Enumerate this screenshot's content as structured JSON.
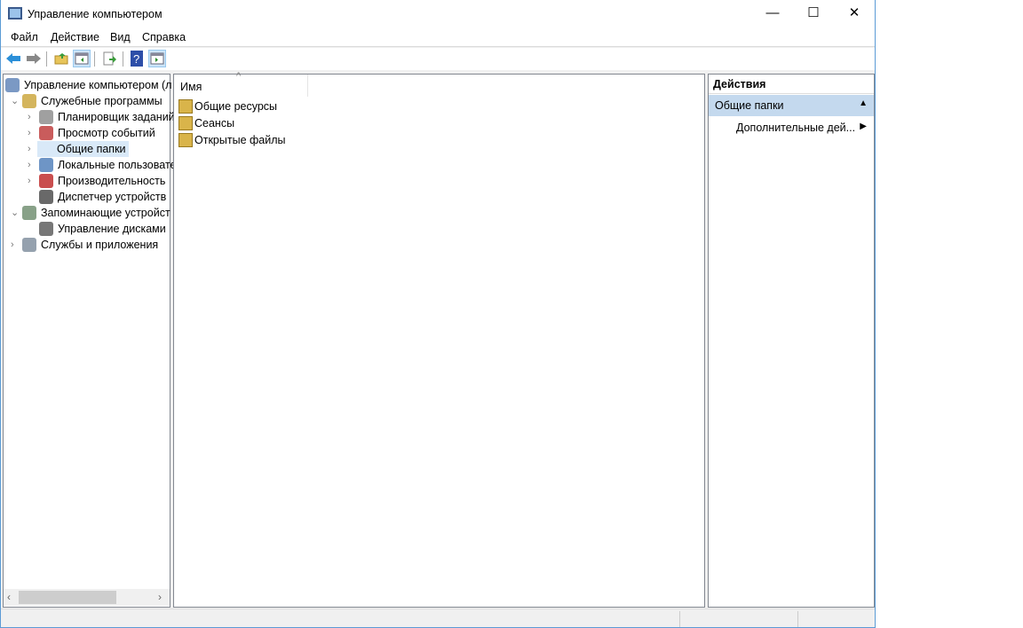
{
  "window": {
    "title": "Управление компьютером",
    "minimize": "—",
    "maximize": "☐",
    "close": "✕"
  },
  "menu": [
    "Файл",
    "Действие",
    "Вид",
    "Справка"
  ],
  "toolbar": {
    "icons": [
      "back-icon",
      "forward-icon",
      "up-folder-icon",
      "show-hide-tree-icon",
      "export-list-icon",
      "help-icon",
      "show-hide-action-pane-icon"
    ]
  },
  "tree": [
    {
      "label": "Управление компьютером (л",
      "level": 0,
      "expander": ""
    },
    {
      "label": "Служебные программы",
      "level": 1,
      "expander": "⌄"
    },
    {
      "label": "Планировщик заданий",
      "level": 2,
      "expander": "›"
    },
    {
      "label": "Просмотр событий",
      "level": 2,
      "expander": "›"
    },
    {
      "label": "Общие папки",
      "level": 2,
      "expander": "›",
      "selected": true
    },
    {
      "label": "Локальные пользовате",
      "level": 2,
      "expander": "›"
    },
    {
      "label": "Производительность",
      "level": 2,
      "expander": "›"
    },
    {
      "label": "Диспетчер устройств",
      "level": 2,
      "expander": ""
    },
    {
      "label": "Запоминающие устройст",
      "level": 1,
      "expander": "⌄"
    },
    {
      "label": "Управление дисками",
      "level": 2,
      "expander": ""
    },
    {
      "label": "Службы и приложения",
      "level": 1,
      "expander": "›"
    }
  ],
  "list": {
    "column": "Имя",
    "items": [
      "Общие ресурсы",
      "Сеансы",
      "Открытые файлы"
    ]
  },
  "actions": {
    "header": "Действия",
    "section": "Общие папки",
    "item": "Дополнительные дей..."
  }
}
